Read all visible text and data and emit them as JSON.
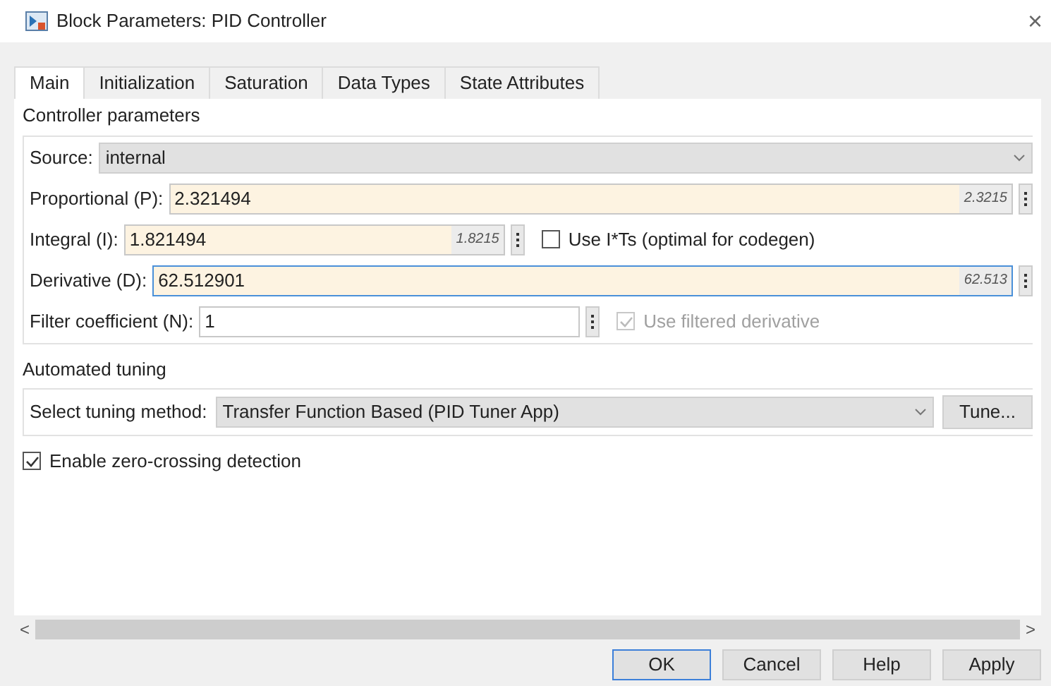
{
  "window": {
    "title": "Block Parameters: PID Controller",
    "close": "×"
  },
  "tabs": [
    {
      "label": "Main",
      "selected": true
    },
    {
      "label": "Initialization",
      "selected": false
    },
    {
      "label": "Saturation",
      "selected": false
    },
    {
      "label": "Data Types",
      "selected": false
    },
    {
      "label": "State Attributes",
      "selected": false
    }
  ],
  "controller_parameters": {
    "legend": "Controller parameters",
    "source": {
      "label": "Source:",
      "value": "internal"
    },
    "fields": [
      {
        "label": "Proportional (P):",
        "value": "2.321494",
        "hint": "2.3215",
        "wide": true,
        "highlighted": true,
        "focused": false
      },
      {
        "label": "Integral (I):",
        "value": "1.821494",
        "hint": "1.8215",
        "wide": false,
        "highlighted": true,
        "focused": false,
        "option": {
          "label": "Use I*Ts (optimal for codegen)",
          "checked": false,
          "disabled": false
        }
      },
      {
        "label": "Derivative (D):",
        "value": "62.512901",
        "hint": "62.513",
        "wide": true,
        "highlighted": true,
        "focused": true
      },
      {
        "label": "Filter coefficient (N):",
        "value": "1",
        "wide": false,
        "highlighted": false,
        "focused": false,
        "option": {
          "label": "Use filtered derivative",
          "checked": true,
          "disabled": true
        }
      }
    ]
  },
  "automated_tuning": {
    "legend": "Automated tuning",
    "label": "Select tuning method:",
    "value": "Transfer Function Based (PID Tuner App)",
    "button": "Tune..."
  },
  "zero_crossing": {
    "label": "Enable zero-crossing detection",
    "checked": true
  },
  "scroll": {
    "left": "<",
    "right": ">"
  },
  "buttons": [
    "OK",
    "Cancel",
    "Help",
    "Apply"
  ]
}
